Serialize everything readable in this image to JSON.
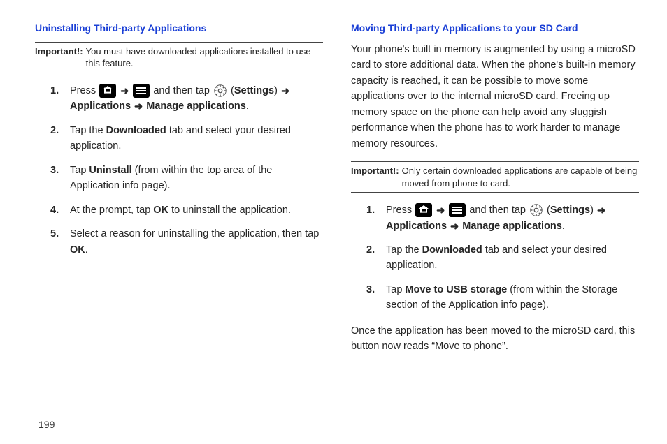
{
  "page_number": "199",
  "left": {
    "title": "Uninstalling Third-party Applications",
    "important_label": "Important!:",
    "important_text": "You must have downloaded applications installed to use this feature.",
    "s1_press": "Press ",
    "s1_andthen": " and then tap ",
    "s1_settings": "Settings",
    "s1_applications": "Applications",
    "s1_manage": "Manage applications",
    "s2a": "Tap the ",
    "s2b": "Downloaded",
    "s2c": " tab and select your desired application.",
    "s3a": "Tap ",
    "s3b": "Uninstall",
    "s3c": " (from within the top area of the Application info page).",
    "s4a": "At the prompt, tap ",
    "s4b": "OK",
    "s4c": " to uninstall the application.",
    "s5a": "Select a reason for uninstalling the application, then tap ",
    "s5b": "OK",
    "s5c": "."
  },
  "right": {
    "title": "Moving Third-party Applications to your SD Card",
    "intro": "Your phone's built in memory is augmented by using a microSD card to store additional data. When the phone's built-in memory capacity is reached, it can be possible to move some applications over to the internal microSD card. Freeing up memory space on the phone can help avoid any sluggish performance when the phone has to work harder to manage memory resources.",
    "important_label": "Important!:",
    "important_text": "Only certain downloaded applications are capable of being moved from phone to card.",
    "s1_press": "Press ",
    "s1_andthen": " and then tap ",
    "s1_settings": "Settings",
    "s1_applications": "Applications",
    "s1_manage": "Manage applications",
    "s2a": "Tap the ",
    "s2b": "Downloaded",
    "s2c": " tab and select your desired application.",
    "s3a": "Tap ",
    "s3b": "Move to USB storage",
    "s3c": " (from within the Storage section of the Application info page).",
    "outro": "Once the application has been moved to the microSD card, this button now reads “Move to phone”."
  },
  "glyphs": {
    "arrow": "➜",
    "open_paren": " (",
    "close_paren_arrow": ") ",
    "period": "."
  }
}
